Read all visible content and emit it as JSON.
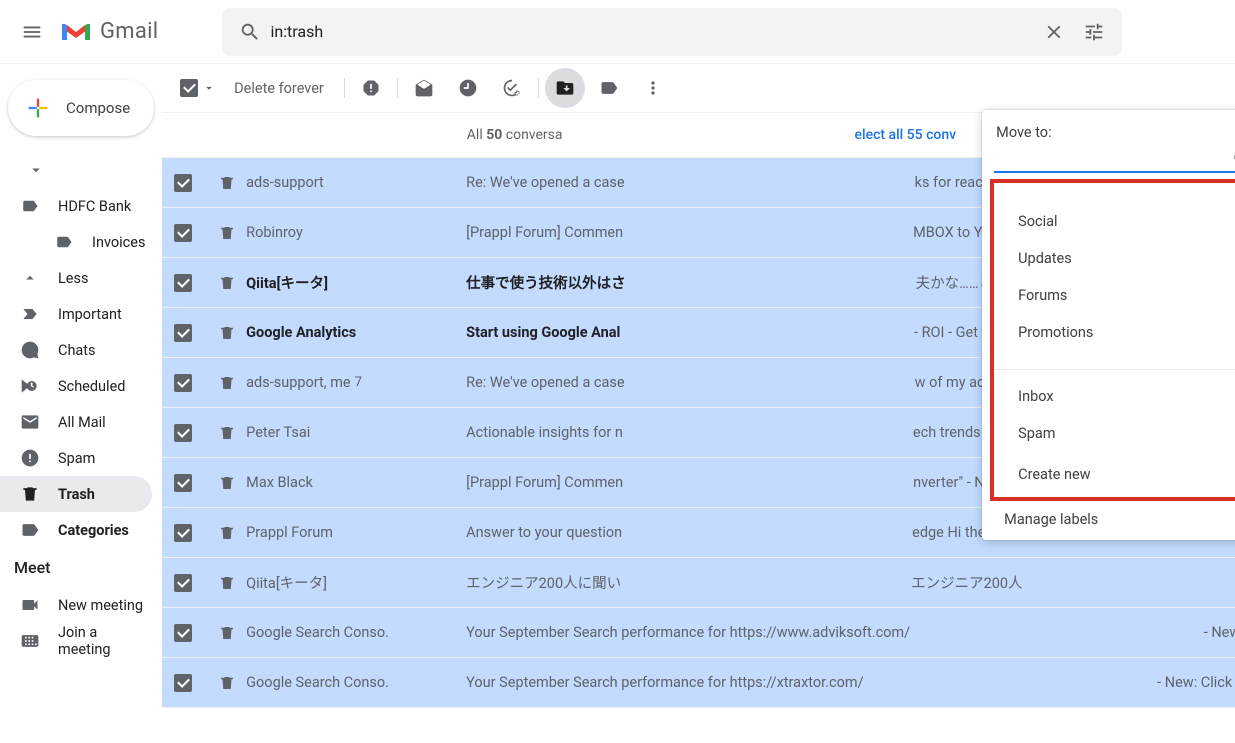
{
  "app": {
    "name": "Gmail"
  },
  "search": {
    "value": "in:trash"
  },
  "compose": {
    "label": "Compose"
  },
  "sidebar": {
    "labels": [
      {
        "name": "HDFC Bank"
      },
      {
        "name": "Invoices"
      }
    ],
    "less": "Less",
    "items": [
      {
        "label": "Important"
      },
      {
        "label": "Chats"
      },
      {
        "label": "Scheduled"
      },
      {
        "label": "All Mail"
      },
      {
        "label": "Spam"
      },
      {
        "label": "Trash"
      },
      {
        "label": "Categories"
      }
    ],
    "meet": {
      "title": "Meet",
      "new_meeting": "New meeting",
      "join_meeting": "Join a meeting"
    }
  },
  "toolbar": {
    "delete_forever": "Delete forever"
  },
  "select_bar": {
    "prefix": "All ",
    "count": "50",
    "suffix": " conversa",
    "link": "elect all 55 conv"
  },
  "moveTo": {
    "title": "Move to:",
    "options_top": [
      "Social",
      "Updates",
      "Forums",
      "Promotions"
    ],
    "options_mid": [
      "Inbox",
      "Spam"
    ],
    "create_new": "Create new",
    "manage": "Manage labels"
  },
  "rows": [
    {
      "unread": false,
      "sender": "ads-support",
      "count": "",
      "subject": "Re: We've opened a case",
      "snippet": "ks for reaching o"
    },
    {
      "unread": false,
      "sender": "Robinroy",
      "count": "",
      "subject": "[Prappl Forum] Commen",
      "snippet": "MBOX to Yahoo m"
    },
    {
      "unread": true,
      "sender": "Qiita[キータ]",
      "count": "",
      "subject": "仕事で使う技術以外はさ",
      "snippet": "夫かな……というス"
    },
    {
      "unread": true,
      "sender": "Google Analytics",
      "count": "",
      "subject": "Start using Google Anal",
      "snippet": "ROI - Get the priva",
      "snippet_sep": " - "
    },
    {
      "unread": false,
      "sender": "ads-support, me",
      "count": "7",
      "subject": "Re: We've opened a case",
      "snippet": "w of my ads are"
    },
    {
      "unread": false,
      "sender": "Peter Tsai",
      "count": "",
      "subject": "Actionable insights for n",
      "snippet": "ech trends - Hi Mi"
    },
    {
      "unread": false,
      "sender": "Max Black",
      "count": "",
      "subject": "[Prappl Forum] Commen",
      "snippet": "nverter\" - New co"
    },
    {
      "unread": false,
      "sender": "Prappl Forum",
      "count": "",
      "subject": "Answer to your question",
      "snippet": "edge Hi there We"
    },
    {
      "unread": false,
      "sender": "Qiita[キータ]",
      "count": "",
      "subject": "エンジニア200人に聞い",
      "snippet": "エンジニア200人"
    },
    {
      "unread": false,
      "sender": "Google Search Conso.",
      "count": "",
      "subject": "Your September Search performance for https://www.adviksoft.com/",
      "snippet": " - New:"
    },
    {
      "unread": false,
      "sender": "Google Search Conso.",
      "count": "",
      "subject": "Your September Search performance for https://xtraxtor.com/",
      "snippet": " - New: Click to"
    }
  ]
}
